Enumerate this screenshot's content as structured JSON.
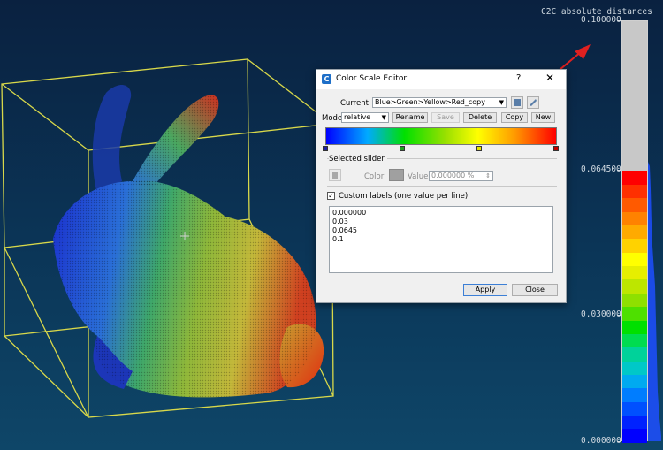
{
  "scalebar": {
    "title": "C2C absolute distances",
    "labels": [
      {
        "text": "0.100000",
        "value": 0.1
      },
      {
        "text": "0.064500",
        "value": 0.0645
      },
      {
        "text": "0.030000",
        "value": 0.03
      },
      {
        "text": "0.000000",
        "value": 0.0
      }
    ],
    "colors": [
      "#0000ff",
      "#0022ff",
      "#0050ff",
      "#007dff",
      "#00aaf0",
      "#00c8c8",
      "#00d29a",
      "#00dc50",
      "#00e000",
      "#4ee000",
      "#8ee000",
      "#bde600",
      "#e6ee00",
      "#ffff00",
      "#ffd200",
      "#ffaa00",
      "#ff8200",
      "#ff5a00",
      "#ff3000",
      "#ff0000"
    ]
  },
  "dialog": {
    "title": "Color Scale Editor",
    "help": "?",
    "close": "✕",
    "current_label": "Current",
    "current_value": "Blue>Green>Yellow>Red_copy",
    "mode_label": "Mode",
    "mode_value": "relative",
    "buttons": {
      "rename": "Rename",
      "save": "Save",
      "delete": "Delete",
      "copy": "Copy",
      "new": "New"
    },
    "selected_slider_label": "Selected slider",
    "color_label": "Color",
    "value_label": "Value",
    "value_field": "0.000000 %",
    "custom_labels_text": "Custom labels (one value per line)",
    "custom_labels_checked": true,
    "custom_labels_values": [
      "0.000000",
      "0.03",
      "0.0645",
      "0.1"
    ],
    "apply": "Apply",
    "close_button": "Close"
  },
  "colors": {
    "sliders": [
      "#2020a0",
      "#20a020",
      "#e6e600",
      "#c00000"
    ]
  }
}
